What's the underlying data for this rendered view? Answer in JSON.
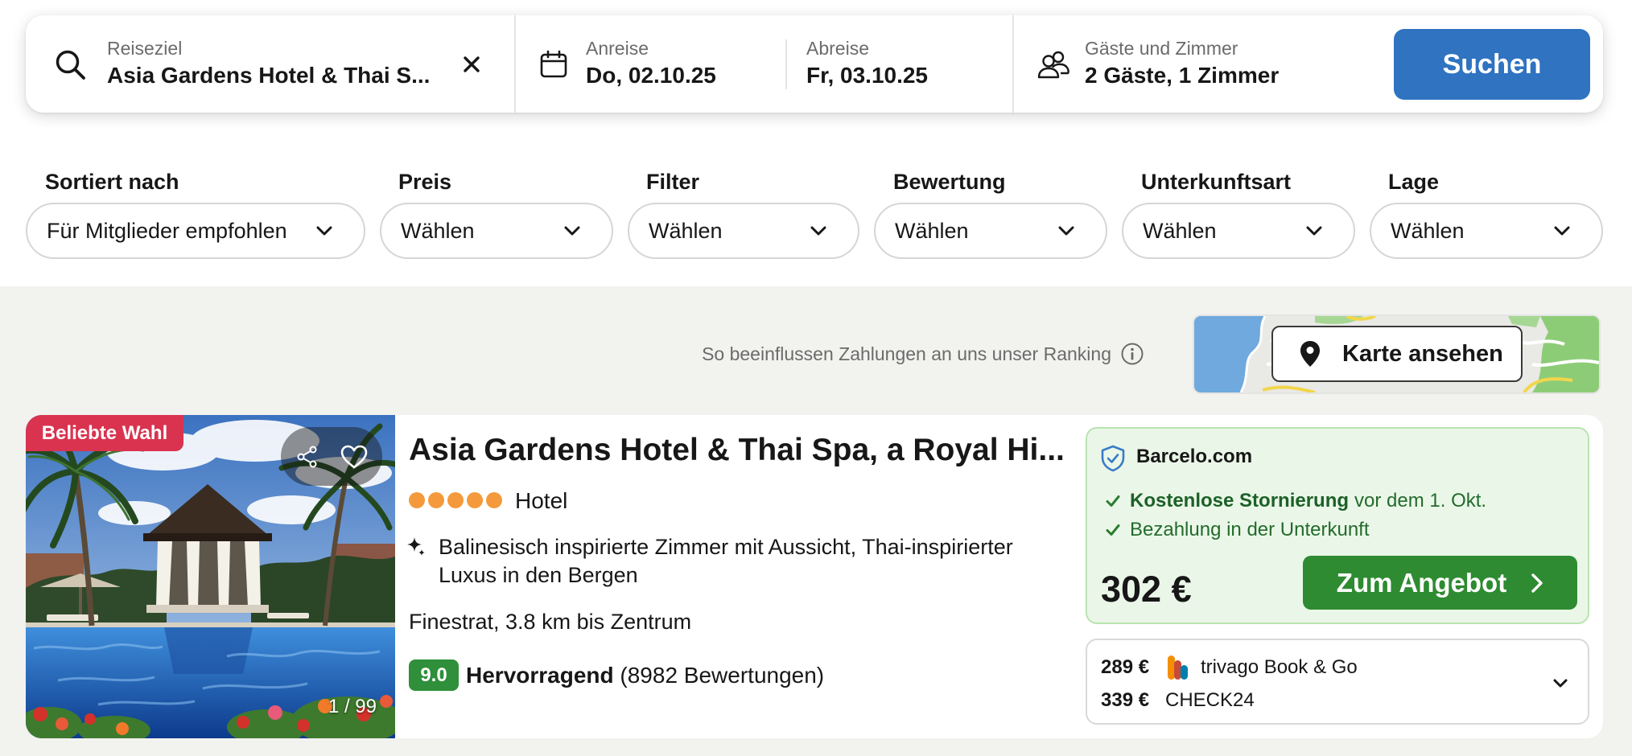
{
  "search": {
    "destination": {
      "label": "Reiseziel",
      "value": "Asia Gardens Hotel & Thai S..."
    },
    "checkin": {
      "label": "Anreise",
      "value": "Do, 02.10.25"
    },
    "checkout": {
      "label": "Abreise",
      "value": "Fr, 03.10.25"
    },
    "guests": {
      "label": "Gäste und Zimmer",
      "value": "2 Gäste, 1 Zimmer"
    },
    "submit_label": "Suchen"
  },
  "filters": [
    {
      "label": "Sortiert nach",
      "value": "Für Mitglieder empfohlen"
    },
    {
      "label": "Preis",
      "value": "Wählen"
    },
    {
      "label": "Filter",
      "value": "Wählen"
    },
    {
      "label": "Bewertung",
      "value": "Wählen"
    },
    {
      "label": "Unterkunftsart",
      "value": "Wählen"
    },
    {
      "label": "Lage",
      "value": "Wählen"
    }
  ],
  "ranking_note": "So beeinflussen Zahlungen an uns unser Ranking",
  "map": {
    "button_label": "Karte ansehen"
  },
  "results": [
    {
      "badge": "Beliebte Wahl",
      "image_counter": "1 / 99",
      "name": "Asia Gardens Hotel & Thai Spa, a Royal Hi...",
      "stars": 5,
      "type": "Hotel",
      "description": "Balinesisch inspirierte Zimmer mit Aussicht, Thai-inspirierter Luxus in den Bergen",
      "location": "Finestrat, 3.8 km bis Zentrum",
      "rating": {
        "score": "9.0",
        "label": "Hervorragend",
        "count": "(8982 Bewertungen)"
      },
      "offer": {
        "provider": "Barcelo.com",
        "perks": [
          {
            "bold": "Kostenlose Stornierung",
            "text": "vor dem 1. Okt."
          },
          {
            "text": "Bezahlung in der Unterkunft"
          }
        ],
        "price": "302 €",
        "cta": "Zum Angebot"
      },
      "more_offers": [
        {
          "price": "289 €",
          "provider": "trivago Book & Go"
        },
        {
          "price": "339 €",
          "provider": "CHECK24"
        }
      ]
    }
  ],
  "icons": {
    "search": "search-icon",
    "clear": "close-icon",
    "calendar": "calendar-icon",
    "guests": "guests-icon",
    "dropdown": "chevron-down-icon",
    "info": "info-icon",
    "map_pin": "map-pin-icon",
    "share": "share-icon",
    "favorite": "heart-icon",
    "highlight": "sparkle-icon",
    "verified": "shield-check-icon",
    "perk": "check-icon",
    "cta": "chevron-right-icon"
  },
  "colors": {
    "accent": "#2f73c1",
    "badge": "#d93350",
    "cta_green": "#2e8b31",
    "rating_green": "#2f8f3a",
    "offer_bg": "#eaf7e8",
    "star": "#f59a3c",
    "page_bg": "#f2f2ef"
  }
}
